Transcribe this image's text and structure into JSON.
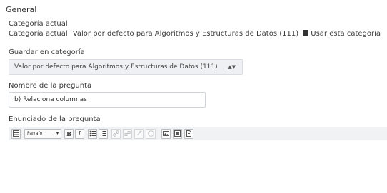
{
  "section": {
    "title": "General"
  },
  "category": {
    "heading": "Categoría actual",
    "label": "Categoría actual",
    "value": "Valor por defecto para Algoritmos y Estructuras de Datos (111)",
    "checkbox_label": "Usar esta categoría",
    "checkbox_checked": true
  },
  "save_category": {
    "label": "Guardar en categoría",
    "selected": "Valor por defecto para Algoritmos y Estructuras de Datos (111)"
  },
  "question_name": {
    "label": "Nombre de la pregunta",
    "value": "b) Relaciona columnas"
  },
  "question_text": {
    "label": "Enunciado de la pregunta",
    "toolbar": {
      "format_select": "Párrafo",
      "bold": "B",
      "italic": "I"
    }
  }
}
